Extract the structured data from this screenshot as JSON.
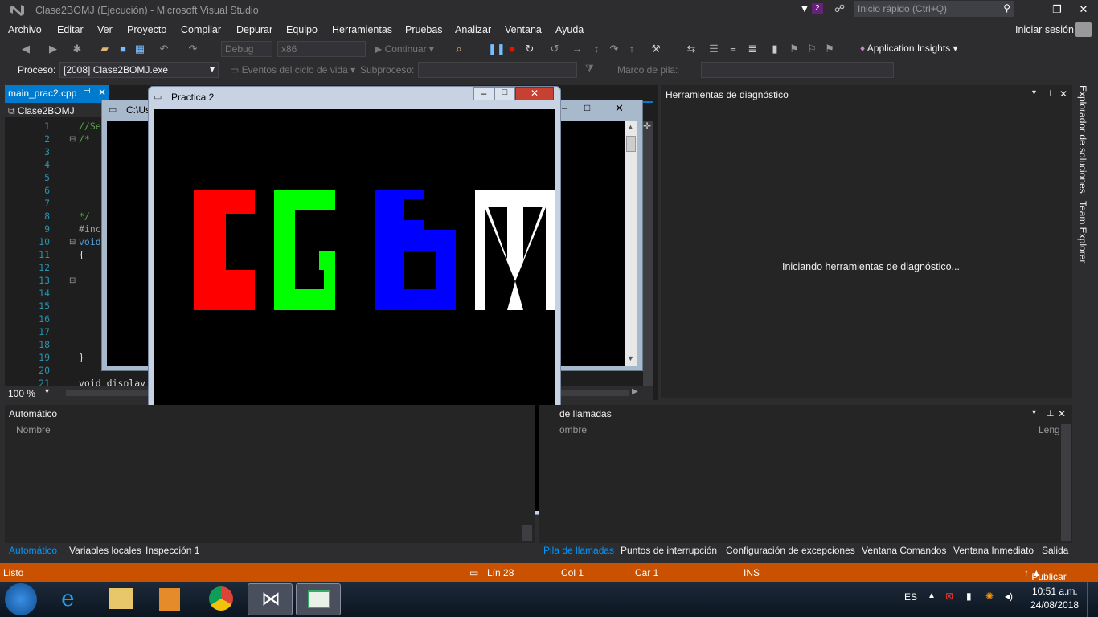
{
  "window": {
    "title": "Clase2BOMJ (Ejecución) - Microsoft Visual Studio",
    "notifications": "2",
    "quick_launch": "Inicio rápido (Ctrl+Q)",
    "sign_in": "Iniciar sesión"
  },
  "menu": [
    "Archivo",
    "Editar",
    "Ver",
    "Proyecto",
    "Compilar",
    "Depurar",
    "Equipo",
    "Herramientas",
    "Pruebas",
    "Analizar",
    "Ventana",
    "Ayuda"
  ],
  "toolbar": {
    "config": "Debug",
    "platform": "x86",
    "continue": "Continuar",
    "app_insights": "Application Insights"
  },
  "process_bar": {
    "process_label": "Proceso:",
    "process_value": "[2008] Clase2BOMJ.exe",
    "lifecycle": "Eventos del ciclo de vida",
    "thread_label": "Subproceso:",
    "stack_label": "Marco de pila:"
  },
  "editor": {
    "tab": "main_prac2.cpp",
    "project": "Clase2BOMJ",
    "zoom": "100 %",
    "lines": [
      "1",
      "2",
      "3",
      "4",
      "5",
      "6",
      "7",
      "8",
      "9",
      "10",
      "11",
      "12",
      "13",
      "14",
      "15",
      "16",
      "17",
      "18",
      "19",
      "20",
      "21"
    ],
    "code": {
      "l1": "//Se",
      "l2": "/*",
      "l8": "*/",
      "l9": "#inc",
      "l10": "void",
      "l11": "{",
      "l19": "}",
      "l21": "void display"
    }
  },
  "console": {
    "title": "C:\\Us"
  },
  "glut_window": {
    "title": "Practica 2",
    "letters_colors": {
      "E": "#ff0000",
      "G": "#00ff00",
      "B": "#0000ff",
      "M": "#ffffff"
    }
  },
  "diag": {
    "title": "Herramientas de diagnóstico",
    "message": "Iniciando herramientas de diagnóstico..."
  },
  "side_tabs": [
    "Explorador de soluciones",
    "Team Explorer"
  ],
  "auto_panel": {
    "title": "Automático",
    "col_name": "Nombre"
  },
  "calls_panel": {
    "title": "de llamadas",
    "col_name": "ombre",
    "col_lang": "Leng"
  },
  "bottom_tabs_left": [
    "Automático",
    "Variables locales",
    "Inspección 1"
  ],
  "bottom_tabs_right": [
    "Pila de llamadas",
    "Puntos de interrupción",
    "Configuración de excepciones",
    "Ventana Comandos",
    "Ventana Inmediato",
    "Salida"
  ],
  "status": {
    "ready": "Listo",
    "line": "Lín 28",
    "col": "Col 1",
    "car": "Car 1",
    "ins": "INS",
    "publish": "Publicar"
  },
  "taskbar": {
    "lang": "ES",
    "time": "10:51 a.m.",
    "date": "24/08/2018"
  },
  "colors": {
    "accent": "#007acc",
    "status": "#ca5100",
    "vs_purple": "#68217a"
  }
}
